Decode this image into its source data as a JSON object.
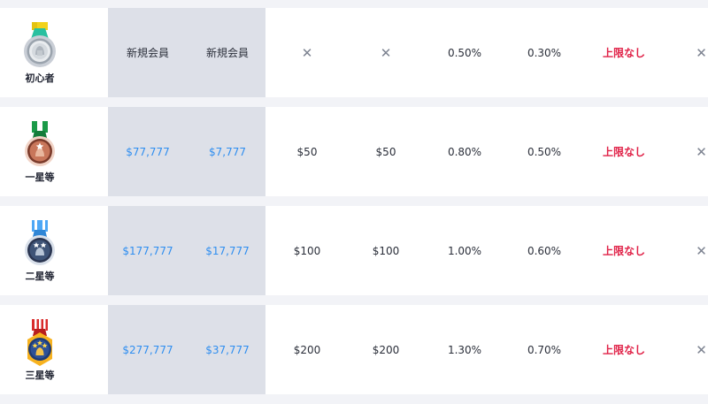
{
  "colors": {
    "row_bg": "#ffffff",
    "page_bg": "#f2f3f7",
    "shade_bg": "#dde0e8",
    "link_blue": "#2f8ef0",
    "alert_red": "#e02147",
    "x_gray": "#7c8290"
  },
  "rows": [
    {
      "level": "初心者",
      "medal_icon": "beginner-medal-icon",
      "a": "新規会員",
      "b": "新規会員",
      "c": "✕",
      "d": "✕",
      "e": "0.50%",
      "f": "0.30%",
      "g": "上限なし",
      "h": "✕"
    },
    {
      "level": "一星等",
      "medal_icon": "one-star-medal-icon",
      "a": "$77,777",
      "b": "$7,777",
      "c": "$50",
      "d": "$50",
      "e": "0.80%",
      "f": "0.50%",
      "g": "上限なし",
      "h": "✕"
    },
    {
      "level": "二星等",
      "medal_icon": "two-star-medal-icon",
      "a": "$177,777",
      "b": "$17,777",
      "c": "$100",
      "d": "$100",
      "e": "1.00%",
      "f": "0.60%",
      "g": "上限なし",
      "h": "✕"
    },
    {
      "level": "三星等",
      "medal_icon": "three-star-medal-icon",
      "a": "$277,777",
      "b": "$37,777",
      "c": "$200",
      "d": "$200",
      "e": "1.30%",
      "f": "0.70%",
      "g": "上限なし",
      "h": "✕"
    }
  ]
}
